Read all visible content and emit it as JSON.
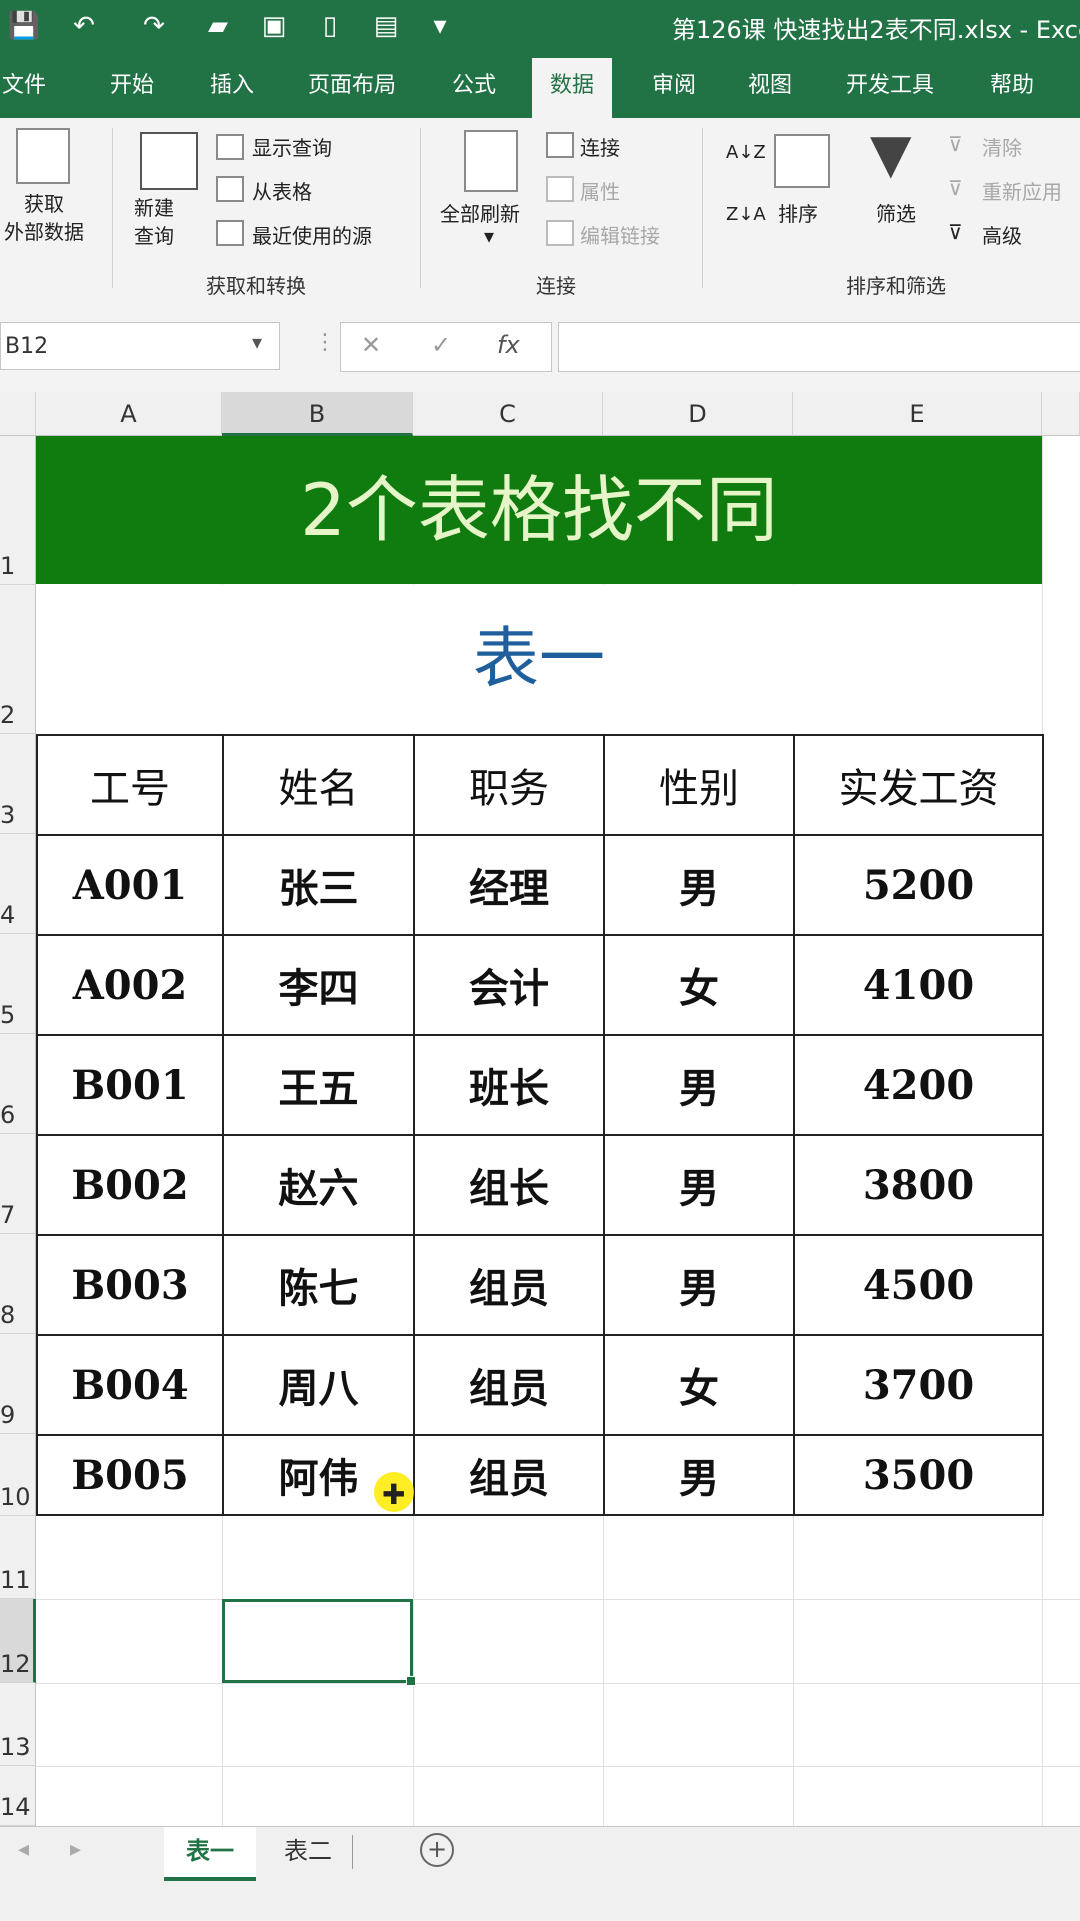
{
  "title_bar": {
    "document_title": "第126课 快速找出2表不同.xlsx - Exce"
  },
  "ribbon_tabs": [
    "文件",
    "开始",
    "插入",
    "页面布局",
    "公式",
    "数据",
    "审阅",
    "视图",
    "开发工具",
    "帮助"
  ],
  "active_tab": "数据",
  "ribbon": {
    "get_data": "获取\n外部数据",
    "new_query": "新建\n查询",
    "show_query": "显示查询",
    "from_table": "从表格",
    "recent_sources": "最近使用的源",
    "group_get_transform": "获取和转换",
    "refresh_all": "全部刷新",
    "connections": "连接",
    "properties": "属性",
    "edit_links": "编辑链接",
    "group_connections": "连接",
    "sort_az": "A↓Z",
    "sort_za": "Z↓A",
    "sort": "排序",
    "filter": "筛选",
    "clear": "清除",
    "reapply": "重新应用",
    "advanced": "高级",
    "group_sort_filter": "排序和筛选"
  },
  "formula_bar": {
    "name_box": "B12",
    "cancel": "✕",
    "enter": "✓",
    "fx": "fx",
    "formula": ""
  },
  "columns": [
    "A",
    "B",
    "C",
    "D",
    "E"
  ],
  "rows": [
    "1",
    "2",
    "3",
    "4",
    "5",
    "6",
    "7",
    "8",
    "9",
    "10",
    "11",
    "12",
    "13",
    "14"
  ],
  "sheet": {
    "banner": "2个表格找不同",
    "subtitle": "表一",
    "headers": [
      "工号",
      "姓名",
      "职务",
      "性别",
      "实发工资"
    ],
    "data": [
      [
        "A001",
        "张三",
        "经理",
        "男",
        "5200"
      ],
      [
        "A002",
        "李四",
        "会计",
        "女",
        "4100"
      ],
      [
        "B001",
        "王五",
        "班长",
        "男",
        "4200"
      ],
      [
        "B002",
        "赵六",
        "组长",
        "男",
        "3800"
      ],
      [
        "B003",
        "陈七",
        "组员",
        "男",
        "4500"
      ],
      [
        "B004",
        "周八",
        "组员",
        "女",
        "3700"
      ],
      [
        "B005",
        "阿伟",
        "组员",
        "男",
        "3500"
      ]
    ]
  },
  "sheet_tabs": [
    "表一",
    "表二"
  ],
  "active_sheet": "表一",
  "colors": {
    "excel_green": "#217346",
    "banner_green": "#107c10",
    "subtitle_blue": "#1f5f9c"
  }
}
